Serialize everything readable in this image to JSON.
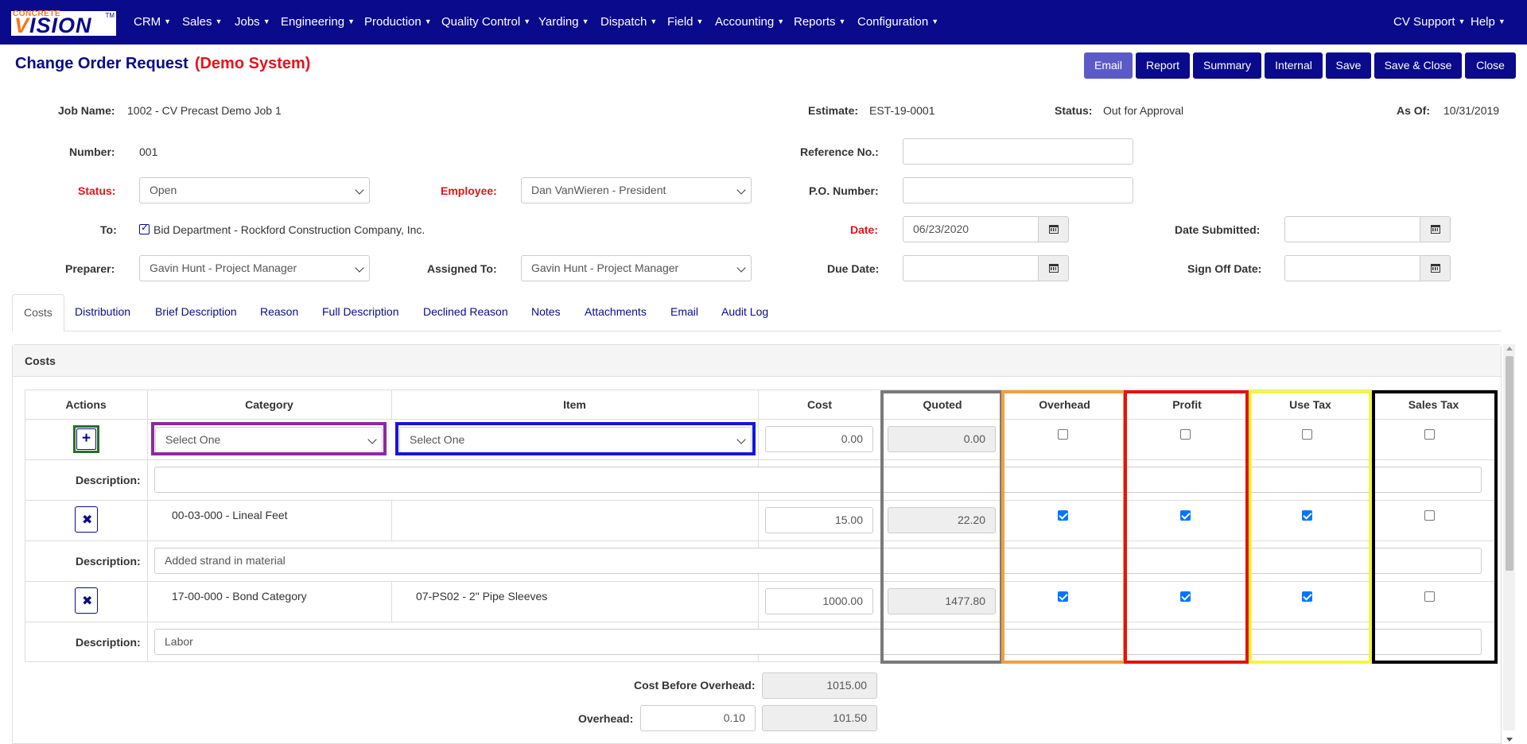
{
  "nav": {
    "logo_top": "CONCRETE",
    "logo_main_a": "V",
    "logo_main_b": "ISION",
    "logo_tm": "TM",
    "items": [
      "CRM",
      "Sales",
      "Jobs",
      "Engineering",
      "Production",
      "Quality Control",
      "Yarding",
      "Dispatch",
      "Field",
      "Accounting",
      "Reports",
      "Configuration"
    ],
    "right": [
      "CV Support",
      "Help"
    ]
  },
  "header": {
    "title": "Change Order Request",
    "demo": "(Demo System)",
    "buttons": [
      "Email",
      "Report",
      "Summary",
      "Internal",
      "Save",
      "Save & Close",
      "Close"
    ]
  },
  "form": {
    "job_name_label": "Job Name:",
    "job_name": "1002 - CV Precast Demo Job 1",
    "estimate_label": "Estimate:",
    "estimate": "EST-19-0001",
    "status_top_label": "Status:",
    "status_top": "Out for Approval",
    "as_of_label": "As Of:",
    "as_of": "10/31/2019",
    "number_label": "Number:",
    "number": "001",
    "reference_label": "Reference No.:",
    "reference": "",
    "status_label": "Status:",
    "status": "Open",
    "employee_label": "Employee:",
    "employee": "Dan VanWieren - President",
    "po_label": "P.O. Number:",
    "po": "",
    "to_label": "To:",
    "to": "Bid Department - Rockford Construction Company, Inc.",
    "date_label": "Date:",
    "date": "06/23/2020",
    "date_submitted_label": "Date Submitted:",
    "date_submitted": "",
    "preparer_label": "Preparer:",
    "preparer": "Gavin Hunt - Project Manager",
    "assigned_label": "Assigned To:",
    "assigned": "Gavin Hunt - Project Manager",
    "due_label": "Due Date:",
    "due": "",
    "signoff_label": "Sign Off Date:",
    "signoff": ""
  },
  "tabs": [
    "Costs",
    "Distribution",
    "Brief Description",
    "Reason",
    "Full Description",
    "Declined Reason",
    "Notes",
    "Attachments",
    "Email",
    "Audit Log"
  ],
  "costs": {
    "panel_title": "Costs",
    "columns": [
      "Actions",
      "Category",
      "Item",
      "Cost",
      "Quoted",
      "Overhead",
      "Profit",
      "Use Tax",
      "Sales Tax"
    ],
    "new_row": {
      "category": "Select One",
      "item": "Select One",
      "cost": "0.00",
      "quoted": "0.00"
    },
    "description_label": "Description:",
    "rows": [
      {
        "category": "00-03-000 - Lineal Feet",
        "item": "",
        "cost": "15.00",
        "quoted": "22.20",
        "overhead": true,
        "profit": true,
        "use_tax": true,
        "sales_tax": false,
        "description": "Added strand in material"
      },
      {
        "category": "17-00-000 - Bond Category",
        "item": "07-PS02 - 2\" Pipe Sleeves",
        "cost": "1000.00",
        "quoted": "1477.80",
        "overhead": true,
        "profit": true,
        "use_tax": true,
        "sales_tax": false,
        "description": "Labor"
      }
    ],
    "summary": {
      "cost_before_overhead_label": "Cost Before Overhead:",
      "cost_before_overhead": "1015.00",
      "overhead_label": "Overhead:",
      "overhead_rate": "0.10",
      "overhead_amount": "101.50"
    }
  },
  "colors": {
    "brand": "#0a0a8c",
    "required": "#e3141b",
    "hl_actions": "#2a6e2a",
    "hl_category": "#8b2a9e",
    "hl_item": "#1515e0",
    "hl_quoted": "#7a7a7a",
    "hl_overhead": "#f0a040",
    "hl_profit": "#e81010",
    "hl_use_tax": "#f5f542",
    "hl_sales_tax": "#000000"
  }
}
